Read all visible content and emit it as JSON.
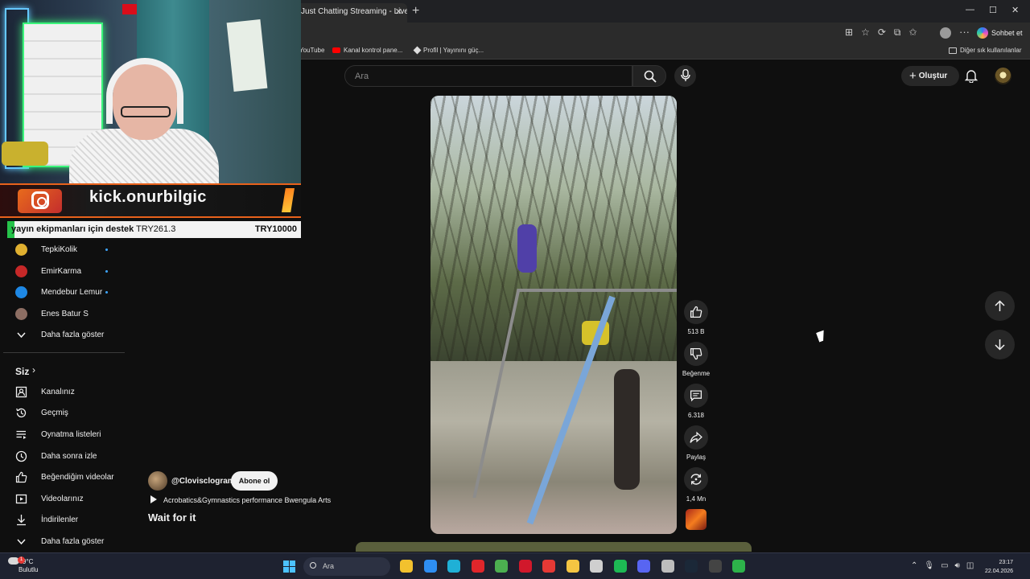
{
  "browser": {
    "tab_title": "Just Chatting Streaming - Live Stre",
    "tab_close": "✕",
    "new_tab": "+",
    "window_controls": [
      "—",
      "☐",
      "✕"
    ],
    "copilot_label": "Sohbet et",
    "bookmarks": [
      {
        "label": "YouTube",
        "icon": "youtube-icon"
      },
      {
        "label": "Kanal kontrol pane...",
        "icon": "youtube-icon"
      },
      {
        "label": "Profil | Yayınını güç...",
        "icon": "diamond-icon"
      }
    ],
    "other_bookmarks": "Diğer sık kullanılanlar"
  },
  "youtube_header": {
    "search_placeholder": "Ara",
    "create_label": "Oluştur"
  },
  "stream_overlay": {
    "banner_text": "kick.onurbilgic",
    "goal_label": "yayın ekipmanları için destek",
    "goal_current": "TRY261.3",
    "goal_target": "TRY10000",
    "goal_progress_percent": 2.6,
    "accent_color": "#e8621c"
  },
  "sidebar": {
    "subscriptions": [
      {
        "label": "TepkiKolik",
        "live": true,
        "avatar_color": "#e0b030"
      },
      {
        "label": "EmirKarma",
        "live": true,
        "avatar_color": "#c62828"
      },
      {
        "label": "Mendebur Lemur",
        "live": true,
        "avatar_color": "#1e88e5"
      },
      {
        "label": "Enes Batur S",
        "live": false,
        "avatar_color": "#8d6e63"
      }
    ],
    "show_more_subs": "Daha fazla göster",
    "you_section": "Siz",
    "you_items": [
      {
        "label": "Kanalınız",
        "icon": "channel-icon"
      },
      {
        "label": "Geçmiş",
        "icon": "history-icon"
      },
      {
        "label": "Oynatma listeleri",
        "icon": "playlists-icon"
      },
      {
        "label": "Daha sonra izle",
        "icon": "watch-later-icon"
      },
      {
        "label": "Beğendiğim videolar",
        "icon": "liked-icon"
      },
      {
        "label": "Videolarınız",
        "icon": "your-videos-icon"
      },
      {
        "label": "İndirilenler",
        "icon": "downloads-icon"
      }
    ],
    "show_more_you": "Daha fazla göster"
  },
  "short": {
    "channel_handle": "@Clovisclogram",
    "subscribe_label": "Abone ol",
    "sound_label": "Acrobatics&Gymnastics performance Bwengula Arts",
    "title": "Wait for it",
    "actions": {
      "likes": "513 B",
      "dislike_label": "Beğenme",
      "comments": "6.318",
      "share_label": "Paylaş",
      "remix_count": "1,4 Mn"
    }
  },
  "taskbar": {
    "temperature": "9°C",
    "weather": "Bulutlu",
    "notification_count": "1",
    "search_label": "Ara",
    "time": "23:17",
    "date": "22.04.2026",
    "apps": [
      {
        "name": "file-explorer-icon",
        "color": "#f2c12e"
      },
      {
        "name": "store-icon",
        "color": "#2e8ef2"
      },
      {
        "name": "edge-icon",
        "color": "#1fb0d6"
      },
      {
        "name": "opera-icon",
        "color": "#e0262b"
      },
      {
        "name": "chrome-icon",
        "color": "#4caf50"
      },
      {
        "name": "opera-gx-icon",
        "color": "#d1182b"
      },
      {
        "name": "yandex-icon",
        "color": "#e53935"
      },
      {
        "name": "folder-icon",
        "color": "#f5c542"
      },
      {
        "name": "apps-icon",
        "color": "#cfcfcf"
      },
      {
        "name": "spotify-icon",
        "color": "#1db954"
      },
      {
        "name": "discord-icon",
        "color": "#5865f2"
      },
      {
        "name": "settings-icon",
        "color": "#bdbdbd"
      },
      {
        "name": "steam-icon",
        "color": "#1b2838"
      },
      {
        "name": "obs-icon",
        "color": "#444444"
      },
      {
        "name": "terminal-icon",
        "color": "#2db34a"
      }
    ]
  }
}
